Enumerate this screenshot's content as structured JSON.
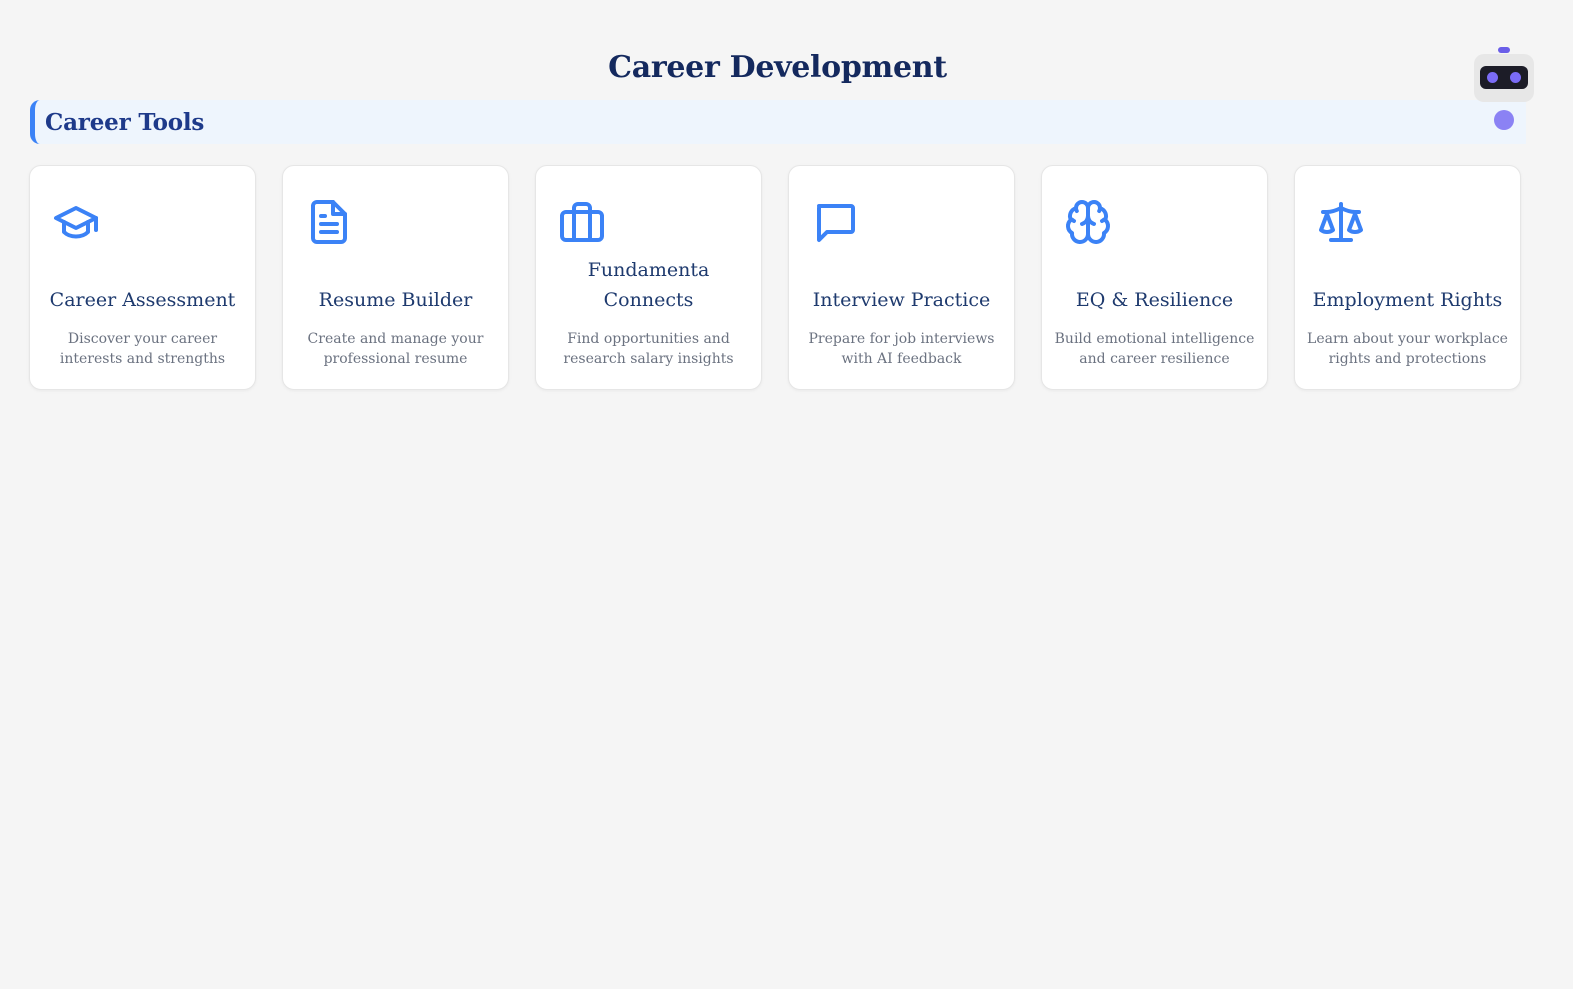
{
  "page": {
    "title": "Career Development"
  },
  "section": {
    "title": "Career Tools"
  },
  "cards": [
    {
      "icon": "graduation-cap-icon",
      "title": "Career Assessment",
      "description": "Discover your career interests and strengths"
    },
    {
      "icon": "document-icon",
      "title": "Resume Builder",
      "description": "Create and manage your professional resume"
    },
    {
      "icon": "briefcase-icon",
      "title": "Fundamenta Connects",
      "description": "Find opportunities and research salary insights"
    },
    {
      "icon": "chat-bubble-icon",
      "title": "Interview Practice",
      "description": "Prepare for job interviews with AI feedback"
    },
    {
      "icon": "brain-icon",
      "title": "EQ & Resilience",
      "description": "Build emotional intelligence and career resilience"
    },
    {
      "icon": "scales-icon",
      "title": "Employment Rights",
      "description": "Learn about your workplace rights and protections"
    }
  ],
  "colors": {
    "accent": "#3b82f6",
    "title": "#14295e",
    "section_bg": "#eef5fd",
    "robot_accent": "#7b6cf6"
  },
  "widgets": {
    "assistant_icon": "robot-icon"
  }
}
